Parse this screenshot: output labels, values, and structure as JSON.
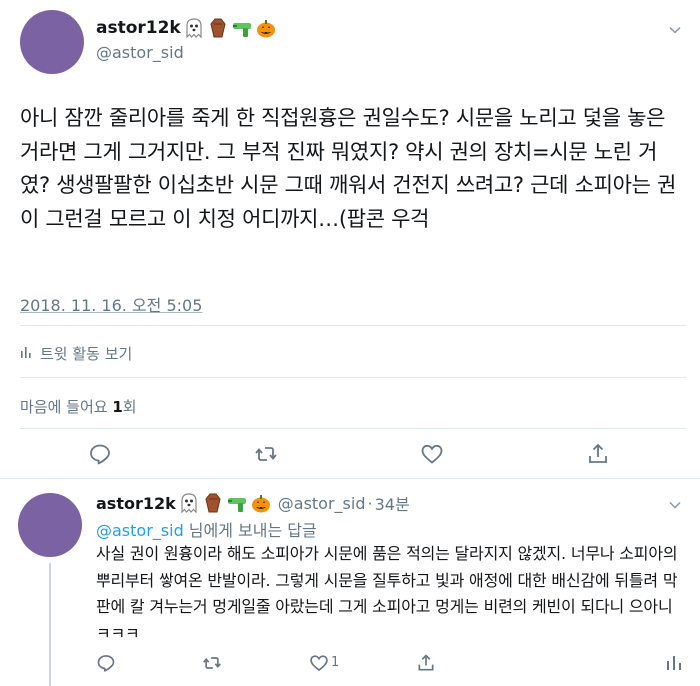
{
  "tweet": {
    "display_name": "astor12k",
    "handle": "@astor_sid",
    "text": "아니 잠깐 줄리아를 죽게 한 직접원흉은 권일수도? 시문을 노리고 덫을 놓은거라면 그게 그거지만. 그 부적 진짜 뭐였지? 약시 권의 장치=시문 노린 거였? 생생팔팔한 이십초반 시문 그때 깨워서 건전지 쓰려고? 근데 소피아는 권이 그런걸 모르고 이 치정 어디까지…(팝콘 우걱",
    "timestamp": "2018. 11. 16. 오전 5:05",
    "activity_label": "트윗 활동 보기",
    "likes_prefix": "마음에 들어요 ",
    "likes_count": "1",
    "likes_suffix": "회"
  },
  "reply": {
    "display_name": "astor12k",
    "handle": "@astor_sid",
    "separator": "·",
    "time": "34분",
    "reply_to_mention": "@astor_sid",
    "reply_to_suffix": " 님에게 보내는 답글",
    "text": "사실 권이 원흉이라 해도 소피아가 시문에 품은 적의는 달라지지 않겠지. 너무나 소피아의 뿌리부터 쌓여온 반발이라. 그렇게 시문을 질투하고 빛과 애정에 대한 배신감에 뒤틀려 막판에 칼 겨누는거 멍게일줄 아랐는데 그게 소피아고 멍게는 비련의 케빈이 되다니 으아니ㅋㅋㅋ",
    "like_count": "1"
  },
  "icons": {
    "emoji_sequence": [
      "ghost-emoji",
      "coffin-emoji",
      "water-pistol-emoji",
      "pumpkin-emoji"
    ],
    "actions": [
      "reply-icon",
      "retweet-icon",
      "like-icon",
      "share-icon"
    ]
  },
  "colors": {
    "avatar": "#7b62a3",
    "mention": "#1da1f2",
    "secondary_text": "#657786"
  }
}
